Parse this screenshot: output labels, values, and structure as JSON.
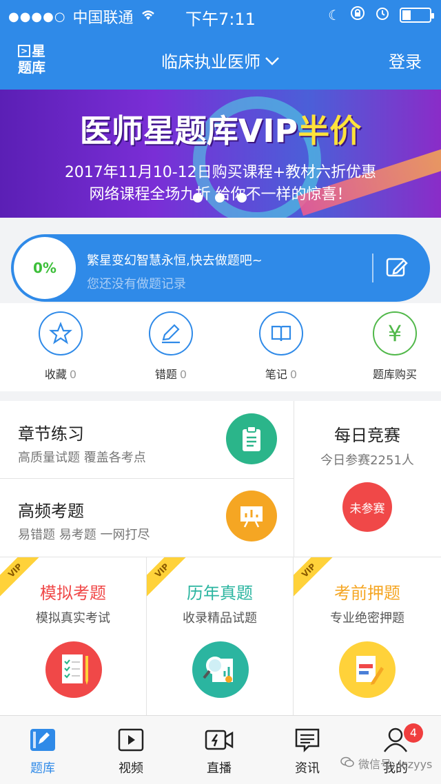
{
  "status_bar": {
    "signal_dots": "●●●●○",
    "carrier": "中国联通",
    "wifi_icon": "wifi-icon",
    "time": "下午7:11"
  },
  "header": {
    "logo_line1": "星",
    "logo_line2": "题库",
    "title": "临床执业医师",
    "login": "登录"
  },
  "banner": {
    "title_part1": "医师星题库VIP",
    "title_part2": "半价",
    "line1": "2017年11月10-12日购买课程+教材六折优惠",
    "line2": "网络课程全场九折 给你不一样的惊喜！"
  },
  "progress": {
    "percent": "0%",
    "message": "繁星变幻智慧永恒,快去做题吧~",
    "sub": "您还没有做题记录"
  },
  "quick_actions": [
    {
      "label": "收藏",
      "count": "0",
      "icon": "star-icon"
    },
    {
      "label": "错题",
      "count": "0",
      "icon": "pencil-icon"
    },
    {
      "label": "笔记",
      "count": "0",
      "icon": "book-icon"
    },
    {
      "label": "题库购买",
      "count": "",
      "icon": "yen-icon"
    }
  ],
  "practice": {
    "chapter": {
      "title": "章节练习",
      "sub": "高质量试题 覆盖各考点"
    },
    "frequent": {
      "title": "高频考题",
      "sub": "易错题 易考题 一网打尽"
    },
    "daily": {
      "title": "每日竞赛",
      "sub": "今日参赛2251人",
      "badge": "未参赛"
    }
  },
  "vip_cards": [
    {
      "tag": "VIP",
      "title": "模拟考题",
      "sub": "模拟真实考试",
      "color": "#f04848"
    },
    {
      "tag": "VIP",
      "title": "历年真题",
      "sub": "收录精品试题",
      "color": "#2bb5a0"
    },
    {
      "tag": "VIP",
      "title": "考前押题",
      "sub": "专业绝密押题",
      "color": "#f5a623"
    }
  ],
  "tabs": [
    {
      "label": "题库"
    },
    {
      "label": "视频"
    },
    {
      "label": "直播"
    },
    {
      "label": "资讯"
    },
    {
      "label": "我的"
    }
  ],
  "notification_count": "4",
  "watermark": "微信号: lczyys",
  "colors": {
    "primary": "#2f8ae8",
    "accent_green": "#51b84a",
    "red": "#f04848"
  }
}
